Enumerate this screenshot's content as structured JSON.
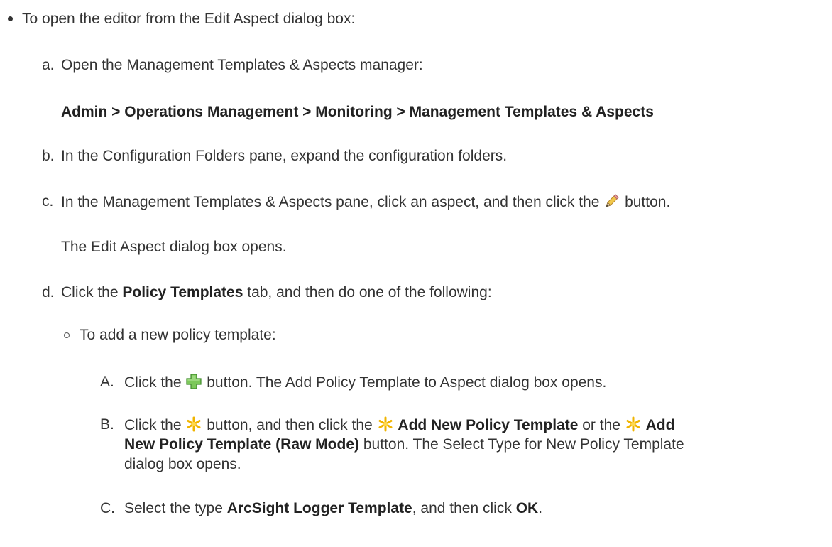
{
  "steps": {
    "intro": "To open the editor from the Edit Aspect dialog box:",
    "a": {
      "marker": "a.",
      "text": "Open the Management Templates & Aspects manager:",
      "path": "Admin > Operations Management > Monitoring > Management Templates & Aspects"
    },
    "b": {
      "marker": "b.",
      "text": "In the Configuration Folders pane, expand the configuration folders."
    },
    "c": {
      "marker": "c.",
      "text_before": "In the Management Templates & Aspects pane, click an aspect, and then click the",
      "text_after": "button.",
      "note": "The Edit Aspect dialog box opens.",
      "icon": "pencil-icon"
    },
    "d": {
      "marker": "d.",
      "text_before": "Click the",
      "bold": "Policy Templates",
      "text_after": "tab, and then do one of the following:",
      "sub": {
        "text": "To add a new policy template:",
        "A": {
          "marker": "A.",
          "text_before": "Click the",
          "text_after": "button. The Add Policy Template to Aspect dialog box opens.",
          "icon": "add-plus-icon"
        },
        "B": {
          "marker": "B.",
          "t1": "Click the",
          "t2": "button, and then click the",
          "bold1": "Add New Policy Template",
          "t3": "or the",
          "bold2_line1": "Add",
          "bold2_line2": "New Policy Template (Raw Mode)",
          "t4": "button. The Select Type for New Policy Template",
          "t5": "dialog box opens.",
          "icon": "new-star-icon"
        },
        "C": {
          "marker": "C.",
          "t1": "Select the type",
          "bold1": "ArcSight Logger Template",
          "t2": ", and then click",
          "bold2": "OK",
          "t3": "."
        }
      }
    }
  }
}
